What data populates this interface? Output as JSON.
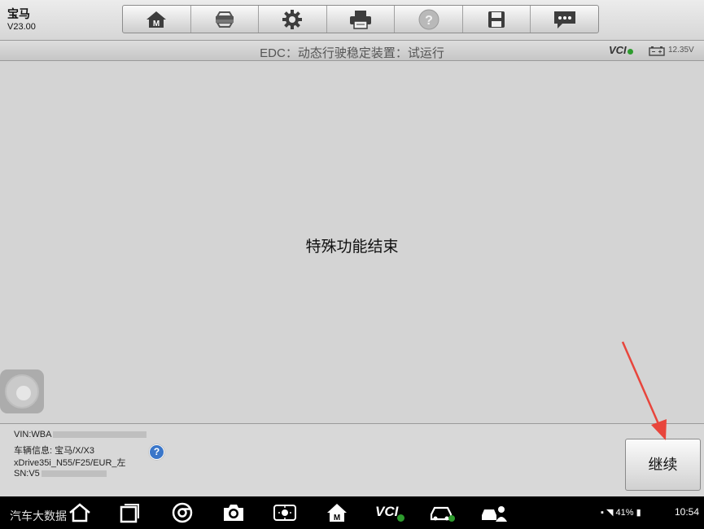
{
  "app": {
    "name": "宝马",
    "version": "V23.00"
  },
  "toolbar": {
    "buttons": [
      {
        "name": "home-icon"
      },
      {
        "name": "vehicle-swap-icon"
      },
      {
        "name": "settings-gear-icon"
      },
      {
        "name": "printer-icon"
      },
      {
        "name": "help-icon"
      },
      {
        "name": "save-disk-icon"
      },
      {
        "name": "message-icon"
      }
    ]
  },
  "titlebar": {
    "title": "EDC：动态行驶稳定装置：试运行",
    "vci_label": "VCI",
    "voltage": "12.35V"
  },
  "main": {
    "message": "特殊功能结束"
  },
  "info": {
    "vin": "VIN:WBA",
    "vehicle_info": "车辆信息: 宝马/X/X3",
    "model": "xDrive35i_N55/F25/EUR_左",
    "sn": "SN:V5"
  },
  "actions": {
    "continue_label": "继续"
  },
  "navbar": {
    "watermark": "汽车大数据",
    "vci_label": "VCI",
    "battery": "41%",
    "time": "10:54"
  },
  "colors": {
    "arrow": "#e8453c",
    "vci_ok": "#2e9c2e",
    "help_blue": "#3a76c9"
  }
}
